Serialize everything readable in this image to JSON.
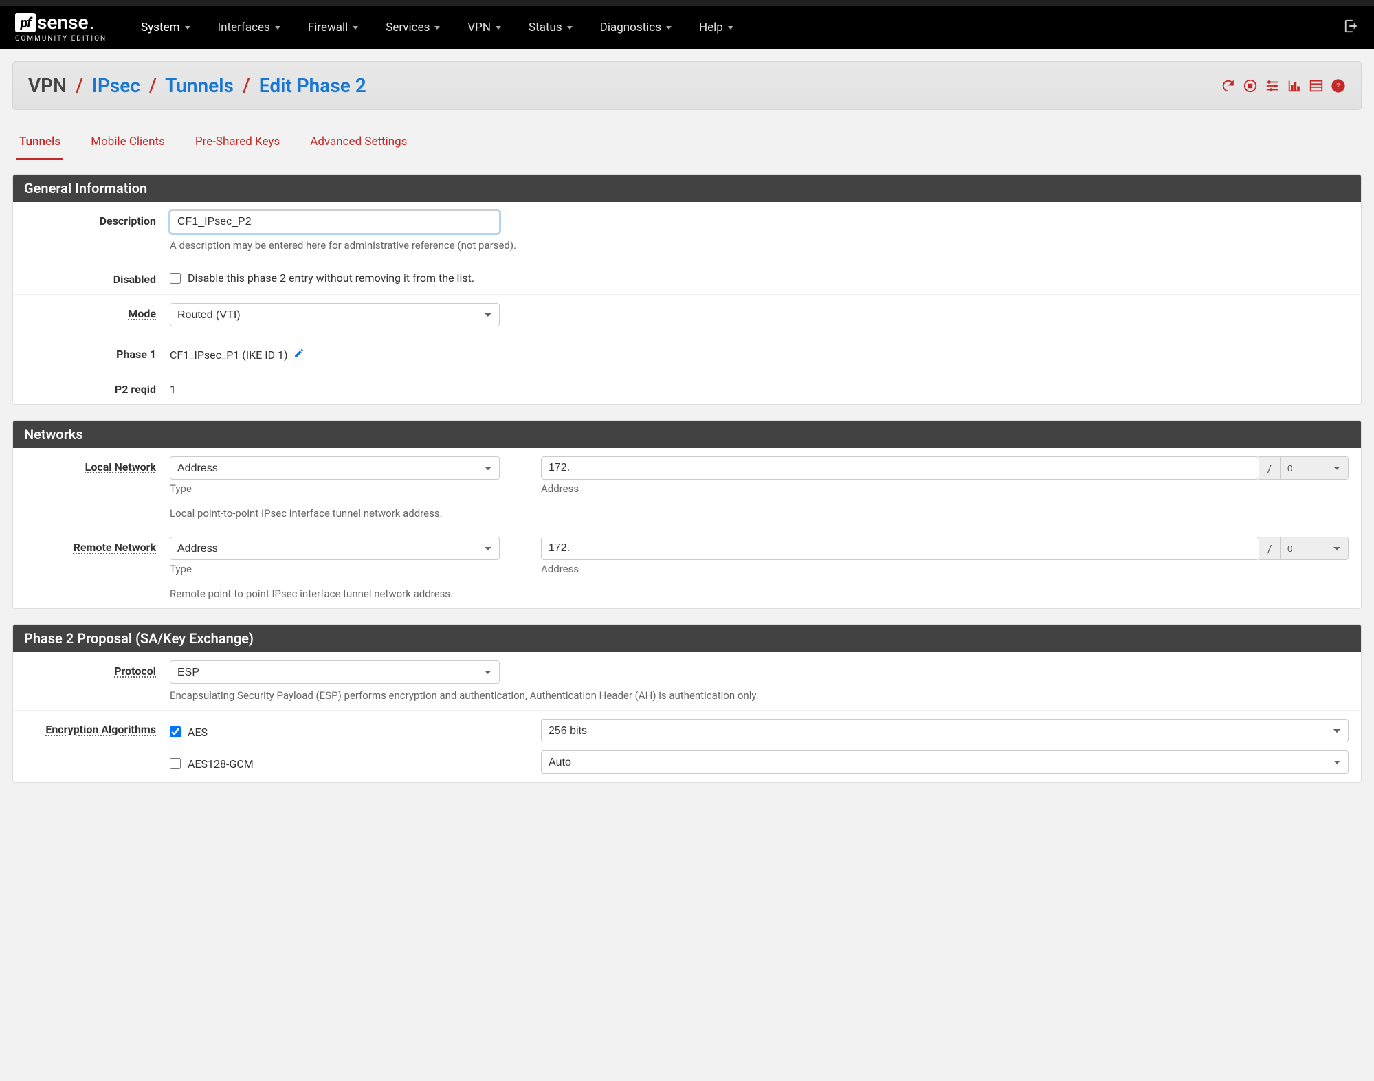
{
  "nav": {
    "items": [
      "System",
      "Interfaces",
      "Firewall",
      "Services",
      "VPN",
      "Status",
      "Diagnostics",
      "Help"
    ],
    "brand_sub": "COMMUNITY EDITION"
  },
  "breadcrumbs": {
    "root": "VPN",
    "l1": "IPsec",
    "l2": "Tunnels",
    "leaf": "Edit Phase 2"
  },
  "tabs": [
    "Tunnels",
    "Mobile Clients",
    "Pre-Shared Keys",
    "Advanced Settings"
  ],
  "active_tab": 0,
  "general": {
    "title": "General Information",
    "description_label": "Description",
    "description_value": "CF1_IPsec_P2",
    "description_help": "A description may be entered here for administrative reference (not parsed).",
    "disabled_label": "Disabled",
    "disabled_text": "Disable this phase 2 entry without removing it from the list.",
    "disabled_checked": false,
    "mode_label": "Mode",
    "mode_value": "Routed (VTI)",
    "phase1_label": "Phase 1",
    "phase1_value": "CF1_IPsec_P1 (IKE ID 1)",
    "reqid_label": "P2 reqid",
    "reqid_value": "1"
  },
  "networks": {
    "title": "Networks",
    "local_label": "Local Network",
    "local_type": "Address",
    "local_type_sub": "Type",
    "local_addr": "172.",
    "local_addr_sub": "Address",
    "local_mask": "0",
    "local_help": "Local point-to-point IPsec interface tunnel network address.",
    "remote_label": "Remote Network",
    "remote_type": "Address",
    "remote_addr": "172.",
    "remote_mask": "0",
    "remote_help": "Remote point-to-point IPsec interface tunnel network address."
  },
  "proposal": {
    "title": "Phase 2 Proposal (SA/Key Exchange)",
    "protocol_label": "Protocol",
    "protocol_value": "ESP",
    "protocol_help": "Encapsulating Security Payload (ESP) performs encryption and authentication, Authentication Header (AH) is authentication only.",
    "enc_label": "Encryption Algorithms",
    "algs": [
      {
        "name": "AES",
        "checked": true,
        "bits": "256 bits"
      },
      {
        "name": "AES128-GCM",
        "checked": false,
        "bits": "Auto"
      }
    ]
  }
}
